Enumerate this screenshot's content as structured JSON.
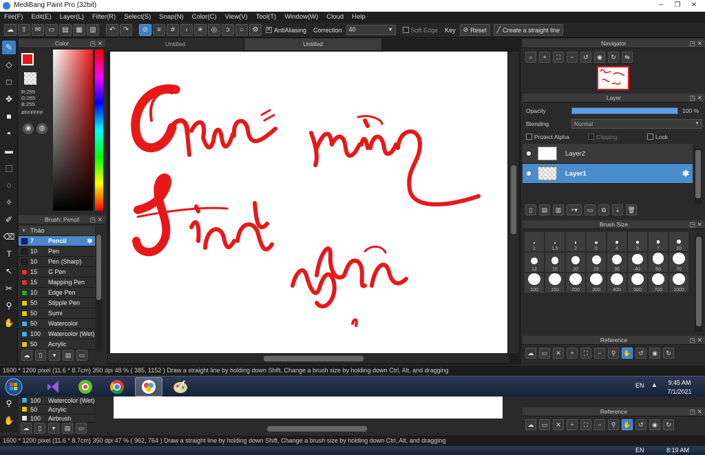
{
  "app": {
    "title": "MediBang Paint Pro (32bit)"
  },
  "menu": [
    "File(F)",
    "Edit(E)",
    "Layer(L)",
    "Filter(R)",
    "Select(S)",
    "Snap(N)",
    "Color(C)",
    "View(V)",
    "Tool(T)",
    "Window(W)",
    "Cloud",
    "Help"
  ],
  "toolbar": {
    "antialiasing": "AntiAliasing",
    "correction_label": "Correction",
    "correction_value": "40",
    "soft_edge": "Soft Edge",
    "key": "Key",
    "reset": "Reset",
    "straight_line": "Create a straight line"
  },
  "color_panel": {
    "title": "Color",
    "r": "R:255",
    "g": "G:255",
    "b": "B:255",
    "hex": "#FFFFFF",
    "current_color": "#e81818"
  },
  "brush_panel": {
    "title": "Brush: Pencil",
    "group": "Thảo",
    "items": [
      {
        "size": "7",
        "name": "Pencil",
        "color": "#1a1a8a",
        "selected": true
      },
      {
        "size": "10",
        "name": "Pen",
        "color": "#222222"
      },
      {
        "size": "10",
        "name": "Pen (Sharp)",
        "color": "#222222"
      },
      {
        "size": "15",
        "name": "G Pen",
        "color": "#e83030"
      },
      {
        "size": "15",
        "name": "Mapping Pen",
        "color": "#e83030"
      },
      {
        "size": "10",
        "name": "Edge Pen",
        "color": "#22aa22"
      },
      {
        "size": "50",
        "name": "Stipple Pen",
        "color": "#e8c800"
      },
      {
        "size": "50",
        "name": "Sumi",
        "color": "#e8c800"
      },
      {
        "size": "50",
        "name": "Watercolor",
        "color": "#40b0e8"
      },
      {
        "size": "100",
        "name": "Watercolor (Wet)",
        "color": "#40b0e8"
      },
      {
        "size": "50",
        "name": "Acrylic",
        "color": "#e8c800"
      }
    ]
  },
  "tabs": [
    "Untitled",
    "Untitled"
  ],
  "canvas": {
    "line1": "Chúc mừng",
    "line2": "Sinh nhật",
    "ink": "#e81818"
  },
  "navigator": {
    "title": "Navigator"
  },
  "layer_panel": {
    "title": "Layer",
    "opacity_label": "Opacity",
    "opacity_value": "100 %",
    "opacity_fraction": 1.0,
    "blending_label": "Blending",
    "blending_value": "Normal",
    "protect_alpha": "Protect Alpha",
    "clipping": "Clipping",
    "lock": "Lock",
    "layers": [
      "Layer2",
      "Layer1"
    ]
  },
  "brush_size": {
    "title": "Brush Size",
    "sizes": [
      "1",
      "1.5",
      "2",
      "3",
      "4",
      "5",
      "7",
      "10",
      "12",
      "15",
      "20",
      "25",
      "30",
      "40",
      "50",
      "70",
      "100",
      "150",
      "200",
      "300",
      "400",
      "500",
      "700",
      "1000"
    ]
  },
  "reference": {
    "title": "Reference"
  },
  "status": {
    "dims": "1600 * 1200 pixel",
    "cm": "(11.6 * 8.7cm)",
    "dpi": "350 dpi",
    "zoom": "48 %",
    "coords": "( 385, 1152 )",
    "hint": "Draw a straight line by holding down Shift, Change a brush size by holding down Ctrl, Alt, and dragging"
  },
  "taskbar": {
    "lang": "EN",
    "time": "9:45 AM",
    "date": "7/1/2021"
  },
  "ghost": {
    "brush_items": [
      "Watercolor (Wet)",
      "Acrylic",
      "Airbrush"
    ],
    "brush_sizes": [
      "100",
      "50",
      "100"
    ],
    "dims": "1600 * 1200 pixel",
    "cm": "(11.6 * 8.7cm)",
    "dpi": "350 dpi",
    "zoom": "47 %",
    "coords": "( 962, 764 )",
    "hint": "Draw a straight line by holding down Shift, Change a brush size by holding down Ctrl, Alt, and dragging",
    "reference": "Reference",
    "lang": "EN",
    "time": "8:19 AM"
  }
}
